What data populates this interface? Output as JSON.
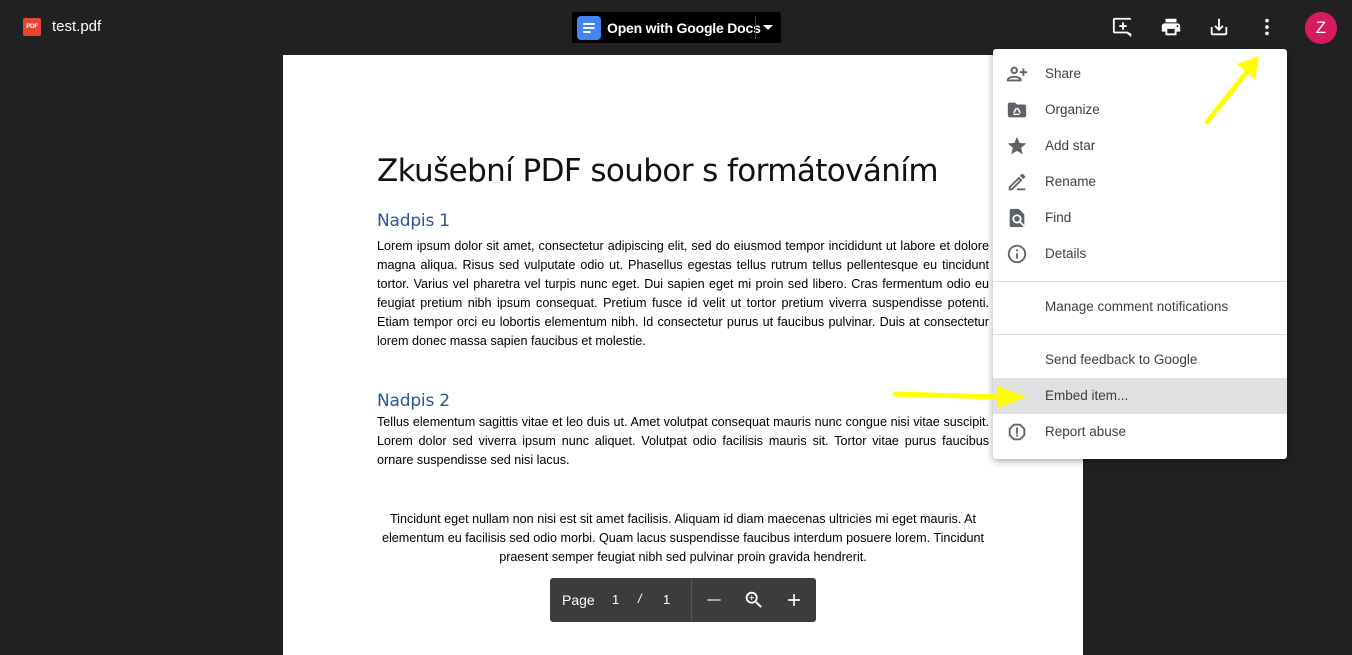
{
  "file": {
    "icon_label": "PDF",
    "name": "test.pdf"
  },
  "open_with": {
    "label": "Open with Google Docs"
  },
  "avatar": {
    "letter": "Z",
    "color": "#d81b60"
  },
  "document": {
    "title": "Zkušební PDF soubor s formátováním",
    "heading1": "Nadpis 1",
    "para1": "Lorem ipsum dolor sit amet, consectetur adipiscing elit, sed do eiusmod tempor incididunt ut labore et dolore magna aliqua. Risus sed vulputate odio ut. Phasellus egestas tellus rutrum tellus pellentesque eu tincidunt tortor. Varius vel pharetra vel turpis nunc eget. Dui sapien eget mi proin sed libero. Cras fermentum odio eu feugiat pretium nibh ipsum consequat. Pretium fusce id velit ut tortor pretium viverra suspendisse potenti. Etiam tempor orci eu lobortis elementum nibh. Id consectetur purus ut faucibus pulvinar. Duis at consectetur lorem donec massa sapien faucibus et molestie.",
    "heading2": "Nadpis 2",
    "para2": "Tellus elementum sagittis vitae et leo duis ut. Amet volutpat consequat mauris nunc congue nisi vitae suscipit. Lorem dolor sed viverra ipsum nunc aliquet. Volutpat odio facilisis mauris sit. Tortor vitae purus faucibus ornare suspendisse sed nisi lacus.",
    "para3": "Tincidunt eget nullam non nisi est sit amet facilisis. Aliquam id diam maecenas ultricies mi eget mauris. At elementum eu facilisis sed odio morbi. Quam lacus suspendisse faucibus interdum posuere lorem. Tincidunt praesent semper feugiat nibh sed pulvinar proin gravida hendrerit."
  },
  "pager": {
    "label": "Page",
    "current": "1",
    "separator": "/",
    "total": "1"
  },
  "menu": {
    "items": [
      {
        "label": "Share",
        "icon": "person-add-icon"
      },
      {
        "label": "Organize",
        "icon": "folder-drive-icon"
      },
      {
        "label": "Add star",
        "icon": "star-icon"
      },
      {
        "label": "Rename",
        "icon": "pencil-icon"
      },
      {
        "label": "Find",
        "icon": "find-in-page-icon"
      },
      {
        "label": "Details",
        "icon": "info-icon"
      },
      {
        "label": "Manage comment notifications",
        "icon": ""
      },
      {
        "label": "Send feedback to Google",
        "icon": ""
      },
      {
        "label": "Embed item...",
        "icon": "",
        "highlighted": true
      },
      {
        "label": "Report abuse",
        "icon": "report-icon"
      }
    ]
  },
  "annotation_color": "#ffff00"
}
